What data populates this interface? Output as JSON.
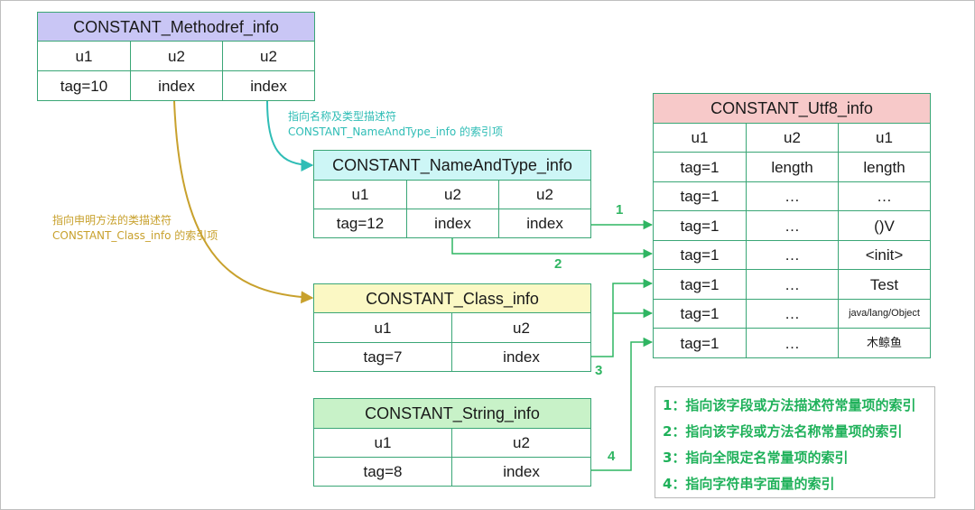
{
  "methodref": {
    "title": "CONSTANT_Methodref_info",
    "types": [
      "u1",
      "u2",
      "u2"
    ],
    "values": [
      "tag=10",
      "index",
      "index"
    ]
  },
  "nameandtype": {
    "title": "CONSTANT_NameAndType_info",
    "types": [
      "u1",
      "u2",
      "u2"
    ],
    "values": [
      "tag=12",
      "index",
      "index"
    ]
  },
  "classinfo": {
    "title": "CONSTANT_Class_info",
    "types": [
      "u1",
      "u2"
    ],
    "values": [
      "tag=7",
      "index"
    ]
  },
  "stringinfo": {
    "title": "CONSTANT_String_info",
    "types": [
      "u1",
      "u2"
    ],
    "values": [
      "tag=8",
      "index"
    ]
  },
  "utf8": {
    "title": "CONSTANT_Utf8_info",
    "types": [
      "u1",
      "u2",
      "u1"
    ],
    "rows": [
      [
        "tag=1",
        "length",
        "length"
      ],
      [
        "tag=1",
        "…",
        "…"
      ],
      [
        "tag=1",
        "…",
        "()V"
      ],
      [
        "tag=1",
        "…",
        "<init>"
      ],
      [
        "tag=1",
        "…",
        "Test"
      ],
      [
        "tag=1",
        "…",
        "java/lang/Object"
      ],
      [
        "tag=1",
        "…",
        "木鲸鱼"
      ]
    ]
  },
  "notes": {
    "nameandtype": [
      "指向名称及类型描述符",
      "CONSTANT_NameAndType_info 的索引项"
    ],
    "classinfo": [
      "指向申明方法的类描述符",
      "CONSTANT_Class_info 的索引项"
    ]
  },
  "edges": [
    "1",
    "2",
    "3",
    "4"
  ],
  "legend": [
    "1：指向该字段或方法描述符常量项的索引",
    "2：指向该字段或方法名称常量项的索引",
    "3：指向全限定名常量项的索引",
    "4：指向字符串字面量的索引"
  ],
  "colors": {
    "border": "#3aa676",
    "arrow_green": "#2fb562",
    "arrow_cyan": "#2fbdb6",
    "arrow_gold": "#c8a12d"
  }
}
